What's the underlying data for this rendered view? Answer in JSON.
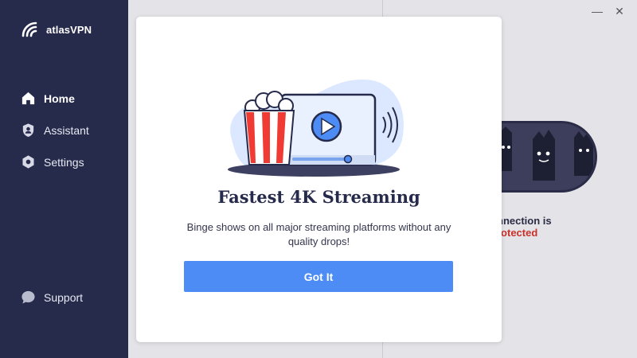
{
  "app": {
    "name": "atlasVPN"
  },
  "sidebar": {
    "items": [
      {
        "label": "Home",
        "icon": "home-icon"
      },
      {
        "label": "Assistant",
        "icon": "assistant-shield-icon"
      },
      {
        "label": "Settings",
        "icon": "gear-icon"
      }
    ],
    "support": {
      "label": "Support",
      "icon": "chat-bubble-icon"
    }
  },
  "main": {
    "connection_line1": "nnection is",
    "connection_line2": "rotected",
    "status_color": "#c8312a"
  },
  "window": {
    "minimize": "—",
    "close": "✕"
  },
  "modal": {
    "title": "Fastest 4K Streaming",
    "description": "Binge shows on all major streaming platforms without any quality drops!",
    "button_label": "Got It"
  },
  "colors": {
    "sidebar": "#262a4b",
    "accent": "#4d8cf5"
  }
}
